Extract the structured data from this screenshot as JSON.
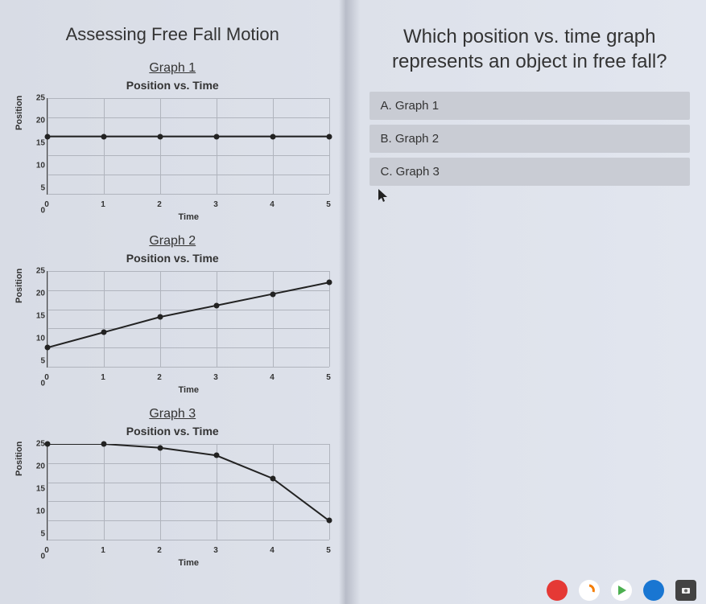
{
  "left": {
    "title": "Assessing Free Fall Motion",
    "graphs": [
      {
        "label": "Graph 1",
        "subtitle": "Position vs. Time",
        "ylabel": "Position",
        "xlabel": "Time"
      },
      {
        "label": "Graph 2",
        "subtitle": "Position vs. Time",
        "ylabel": "Position",
        "xlabel": "Time"
      },
      {
        "label": "Graph 3",
        "subtitle": "Position vs. Time",
        "ylabel": "Position",
        "xlabel": "Time"
      }
    ]
  },
  "right": {
    "question": "Which position vs. time graph represents an object in free fall?",
    "answers": [
      "A. Graph 1",
      "B. Graph 2",
      "C. Graph 3"
    ]
  },
  "chart_data": [
    {
      "type": "line",
      "title": "Graph 1 – Position vs. Time",
      "xlabel": "Time",
      "ylabel": "Position",
      "xlim": [
        0,
        5
      ],
      "ylim": [
        0,
        25
      ],
      "x": [
        0,
        1,
        2,
        3,
        4,
        5
      ],
      "y": [
        15,
        15,
        15,
        15,
        15,
        15
      ]
    },
    {
      "type": "line",
      "title": "Graph 2 – Position vs. Time",
      "xlabel": "Time",
      "ylabel": "Position",
      "xlim": [
        0,
        5
      ],
      "ylim": [
        0,
        25
      ],
      "x": [
        0,
        1,
        2,
        3,
        4,
        5
      ],
      "y": [
        5,
        9,
        13,
        16,
        19,
        22
      ]
    },
    {
      "type": "line",
      "title": "Graph 3 – Position vs. Time",
      "xlabel": "Time",
      "ylabel": "Position",
      "xlim": [
        0,
        5
      ],
      "ylim": [
        0,
        25
      ],
      "x": [
        0,
        1,
        2,
        3,
        4,
        5
      ],
      "y": [
        25,
        25,
        24,
        22,
        16,
        5
      ]
    }
  ],
  "yticks": [
    "25",
    "20",
    "15",
    "10",
    "5",
    "0"
  ],
  "xticks": [
    "0",
    "1",
    "2",
    "3",
    "4",
    "5"
  ]
}
